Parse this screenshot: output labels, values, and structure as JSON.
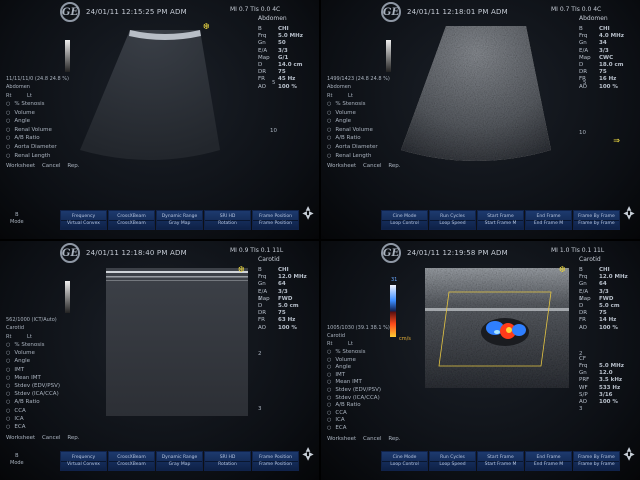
{
  "colors": {
    "focus": "#e2cf40",
    "button": "#1d3a6e",
    "doppler_red": "#ff3b1a",
    "doppler_blue": "#2f7fff"
  },
  "q1": {
    "timestamp": "24/01/11 12:15:25 PM ADM",
    "mi_ti": "MI 0.7  TIs 0.0  4C",
    "preset": "Abdomen",
    "mode_line": "11/11/11/0   (24.8 24.8 %)",
    "group": "Abdomen",
    "rl": [
      "Rt",
      "Lt"
    ],
    "calcs": [
      "% Stenosis",
      "Volume",
      "Angle",
      "Renal Volume",
      "A/B Ratio",
      "Aorta Diameter",
      "Renal Length"
    ],
    "worksheet": [
      "Worksheet",
      "Cancel Rep."
    ],
    "depth": [
      "5",
      "10"
    ],
    "params": [
      [
        "B",
        "CHI"
      ],
      [
        "Frq",
        "5.0 MHz"
      ],
      [
        "Gn",
        "50"
      ],
      [
        "E/A",
        "3/3"
      ],
      [
        "Map",
        "G/1"
      ],
      [
        "D",
        "14.0 cm"
      ],
      [
        "DR",
        "75"
      ],
      [
        "FR",
        "45 Hz"
      ],
      [
        "AO",
        "100 %"
      ]
    ],
    "bottom_left": [
      "B",
      "Mode"
    ],
    "buttons": [
      [
        "Frequency",
        "Virtual Convex"
      ],
      [
        "CrossXBeam",
        "CrossXBeam"
      ],
      [
        "Dynamic Range",
        "Gray Map"
      ],
      [
        "SRI HD",
        "Rotation"
      ],
      [
        "Frame Position",
        "Frame Position"
      ]
    ]
  },
  "q2": {
    "timestamp": "24/01/11 12:18:01 PM ADM",
    "mi_ti": "MI 0.7  TIs 0.0  4C",
    "preset": "Abdomen",
    "mode_line": "1499/1423   (24.8 24.8 %)",
    "group": "Abdomen",
    "rl": [
      "Rt",
      "Lt"
    ],
    "calcs": [
      "% Stenosis",
      "Volume",
      "Angle",
      "Renal Volume",
      "A/B Ratio",
      "Aorta Diameter",
      "Renal Length"
    ],
    "worksheet": [
      "Worksheet",
      "Cancel Rep."
    ],
    "depth": [
      "5",
      "10"
    ],
    "params": [
      [
        "B",
        "CHI"
      ],
      [
        "Frq",
        "4.0 MHz"
      ],
      [
        "Gn",
        "34"
      ],
      [
        "E/A",
        "3/3"
      ],
      [
        "Map",
        "CWC"
      ],
      [
        "D",
        "18.0 cm"
      ],
      [
        "DR",
        "75"
      ],
      [
        "FR",
        "16 Hz"
      ],
      [
        "AO",
        "100 %"
      ]
    ],
    "buttons": [
      [
        "Cine Mode",
        "Loop Control"
      ],
      [
        "Run Cycles",
        "Loop Speed"
      ],
      [
        "Start Frame",
        "Start Frame M"
      ],
      [
        "End Frame",
        "End Frame M"
      ],
      [
        "Frame By Frame",
        "Frame by Frame"
      ]
    ]
  },
  "q3": {
    "timestamp": "24/01/11 12:18:40 PM ADM",
    "mi_ti": "MI 0.9  TIs 0.1  11L",
    "preset": "Carotid",
    "mode_line": "562/1000   (ICT/Auto)",
    "group": "Carotid",
    "rl": [
      "Rt",
      "Lt"
    ],
    "calcs": [
      "% Stenosis",
      "Volume",
      "Angle",
      "IMT",
      "Mean IMT",
      "Stdev (EDV/PSV)",
      "Stdev (ICA/CCA)",
      "A/B Ratio",
      "CCA",
      "ICA",
      "ECA"
    ],
    "worksheet": [
      "Worksheet",
      "Cancel Rep."
    ],
    "depth": [
      "1",
      "2",
      "3"
    ],
    "params": [
      [
        "B",
        "CHI"
      ],
      [
        "Frq",
        "12.0 MHz"
      ],
      [
        "Gn",
        "64"
      ],
      [
        "E/A",
        "3/3"
      ],
      [
        "Map",
        "FWD"
      ],
      [
        "D",
        "5.0 cm"
      ],
      [
        "DR",
        "75"
      ],
      [
        "FR",
        "63 Hz"
      ],
      [
        "AO",
        "100 %"
      ]
    ],
    "bottom_left": [
      "B",
      "Mode"
    ],
    "buttons": [
      [
        "Frequency",
        "Virtual Convex"
      ],
      [
        "CrossXBeam",
        "CrossXBeam"
      ],
      [
        "Dynamic Range",
        "Gray Map"
      ],
      [
        "SRI HD",
        "Rotation"
      ],
      [
        "Frame Position",
        "Frame Position"
      ]
    ]
  },
  "q4": {
    "timestamp": "24/01/11 12:19:58 PM ADM",
    "mi_ti": "MI 1.0  TIs 0.1  11L",
    "preset": "Carotid",
    "mode_line": "1005/1030   (39.1 38.1 %)",
    "group": "Carotid",
    "rl": [
      "Rt",
      "Lt"
    ],
    "calcs": [
      "% Stenosis",
      "Volume",
      "Angle",
      "IMT",
      "Mean IMT",
      "Stdev (EDV/PSV)",
      "Stdev (ICA/CCA)",
      "A/B Ratio",
      "CCA",
      "ICA",
      "ECA"
    ],
    "worksheet": [
      "Worksheet",
      "Cancel Rep."
    ],
    "depth": [
      "1",
      "2",
      "3"
    ],
    "cb_top": "31",
    "cb_bot": "cm/s",
    "params": [
      [
        "B",
        "CHI"
      ],
      [
        "Frq",
        "12.0 MHz"
      ],
      [
        "Gn",
        "64"
      ],
      [
        "E/A",
        "3/3"
      ],
      [
        "Map",
        "FWD"
      ],
      [
        "D",
        "5.0 cm"
      ],
      [
        "DR",
        "75"
      ],
      [
        "FR",
        "14 Hz"
      ],
      [
        "AO",
        "100 %"
      ]
    ],
    "params_cf": [
      [
        "CF",
        ""
      ],
      [
        "Frq",
        "5.0 MHz"
      ],
      [
        "Gn",
        "12.0"
      ],
      [
        "PRF",
        "3.5 kHz"
      ],
      [
        "WF",
        "533 Hz"
      ],
      [
        "S/P",
        "3/16"
      ],
      [
        "AO",
        "100 %"
      ]
    ],
    "buttons": [
      [
        "Cine Mode",
        "Loop Control"
      ],
      [
        "Run Cycles",
        "Loop Speed"
      ],
      [
        "Start Frame",
        "Start Frame M"
      ],
      [
        "End Frame",
        "End Frame M"
      ],
      [
        "Frame By Frame",
        "Frame by Frame"
      ]
    ]
  }
}
